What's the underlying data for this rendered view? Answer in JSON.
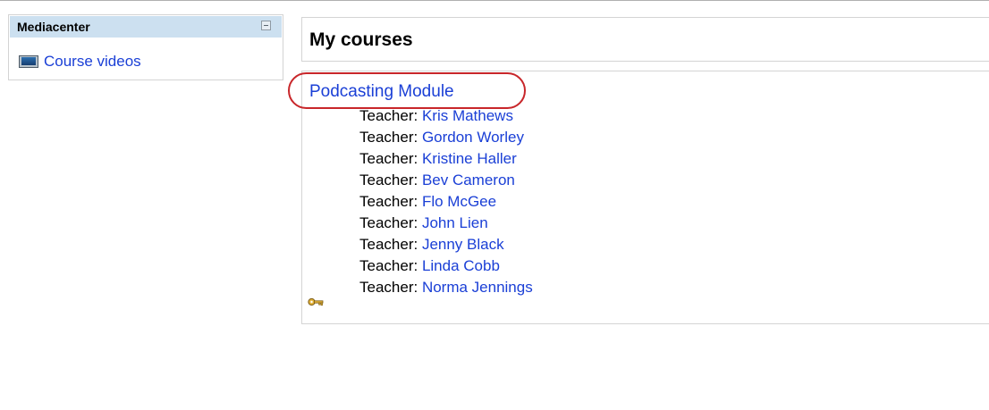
{
  "sidebar": {
    "block_title": "Mediacenter",
    "items": [
      {
        "label": "Course videos",
        "icon": "tv-icon"
      }
    ]
  },
  "main": {
    "title": "My courses",
    "course": {
      "name": "Podcasting Module",
      "teacher_label": "Teacher:",
      "teachers": [
        "Kris Mathews",
        "Gordon Worley",
        "Kristine Haller",
        "Bev Cameron",
        "Flo McGee",
        "John Lien",
        "Jenny Black",
        "Linda Cobb",
        "Norma Jennings"
      ],
      "enrol_icon": "key-icon"
    }
  },
  "colors": {
    "link": "#1a3fd6",
    "block_header": "#cce0f0",
    "annotation": "#c8262a"
  }
}
